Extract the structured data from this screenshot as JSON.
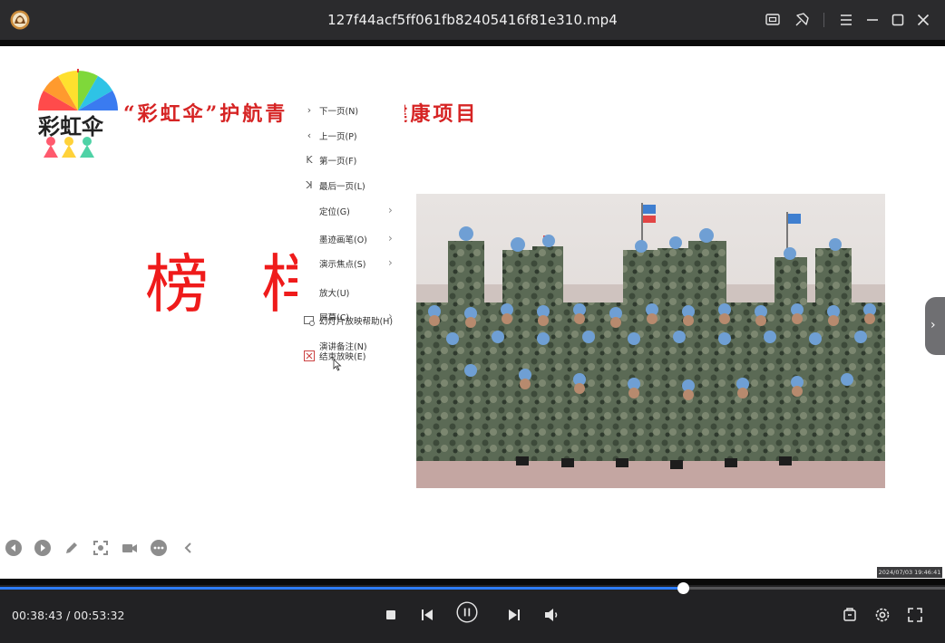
{
  "window": {
    "title": "127f44acf5ff061fb82405416f81e310.mp4",
    "icons": [
      "app-logo-icon",
      "screenshot-icon",
      "pin-icon",
      "menu-icon",
      "minimize-icon",
      "maximize-icon",
      "close-icon"
    ]
  },
  "slide": {
    "heading": "“彩虹伞”护航青",
    "heading_tail": "建康项目",
    "logo_text": "彩虹伞",
    "big_chars": [
      "榜",
      "样"
    ]
  },
  "context_menu": {
    "items": [
      {
        "icon": "chevron-right-icon",
        "label": "下一页(N)",
        "submenu": false
      },
      {
        "icon": "chevron-left-icon",
        "label": "上一页(P)",
        "submenu": false
      },
      {
        "icon": "first-page-icon",
        "label": "第一页(F)",
        "submenu": false
      },
      {
        "icon": "last-page-icon",
        "label": "最后一页(L)",
        "submenu": false
      },
      {
        "icon": "",
        "label": "定位(G)",
        "submenu": true
      },
      {
        "icon": "",
        "label": "墨迹画笔(O)",
        "submenu": true
      },
      {
        "icon": "",
        "label": "演示焦点(S)",
        "submenu": true
      },
      {
        "icon": "",
        "label": "放大(U)",
        "submenu": false
      },
      {
        "icon": "",
        "label": "屏幕(C)",
        "submenu": true
      },
      {
        "icon": "",
        "label": "演讲备注(N)",
        "submenu": false
      },
      {
        "icon": "slideshow-help-icon",
        "label": "幻灯片放映帮助(H)",
        "submenu": false
      },
      {
        "icon": "end-show-icon",
        "label": "结束放映(E)",
        "submenu": false
      }
    ]
  },
  "slide_tools": [
    "prev-slide-icon",
    "next-slide-icon",
    "pen-icon",
    "focus-icon",
    "camera-icon",
    "more-icon",
    "collapse-icon"
  ],
  "overlay": {
    "timestamp": "2024/07/03 19:46:41"
  },
  "player": {
    "current_time": "00:38:43",
    "total_time": "00:53:32",
    "time_display": "00:38:43 / 00:53:32",
    "progress": 0.7233,
    "accent": "#2d7cf6"
  }
}
